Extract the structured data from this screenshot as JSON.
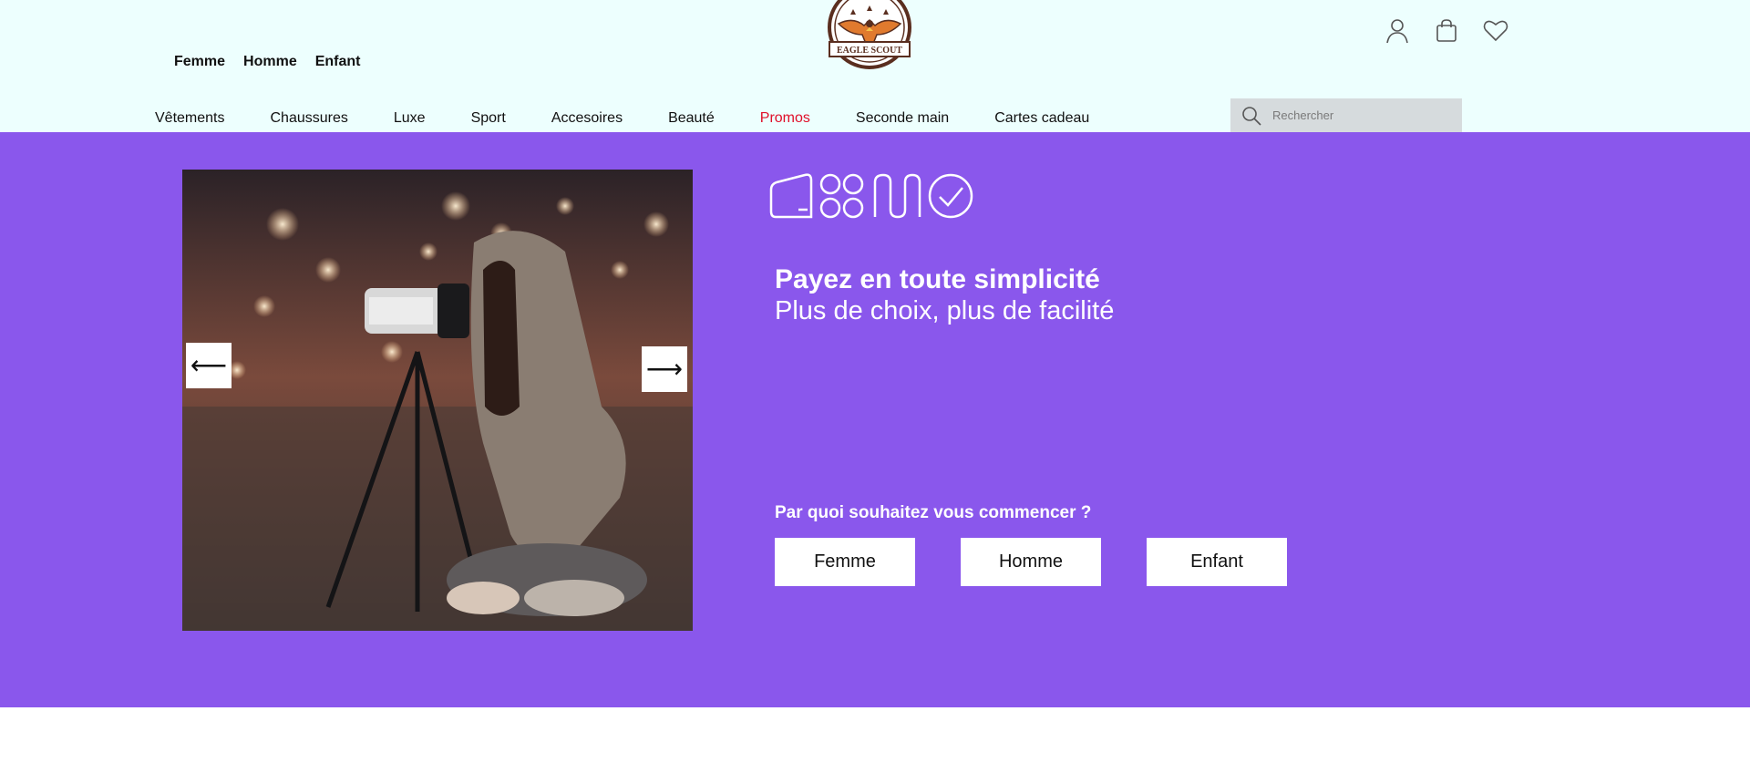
{
  "header": {
    "logo_text": "EAGLE SCOUT",
    "gender_links": [
      "Femme",
      "Homme",
      "Enfant"
    ],
    "icons": [
      "user-icon",
      "bag-icon",
      "heart-icon"
    ],
    "categories": [
      {
        "label": "Vêtements",
        "color": "#111111"
      },
      {
        "label": "Chaussures",
        "color": "#111111"
      },
      {
        "label": "Luxe",
        "color": "#111111"
      },
      {
        "label": "Sport",
        "color": "#111111"
      },
      {
        "label": "Accesoires",
        "color": "#111111"
      },
      {
        "label": "Beauté",
        "color": "#111111"
      },
      {
        "label": "Promos",
        "color": "#e0102a"
      },
      {
        "label": "Seconde main",
        "color": "#111111"
      },
      {
        "label": "Cartes cadeau",
        "color": "#111111"
      }
    ],
    "search": {
      "placeholder": "Rechercher",
      "value": ""
    }
  },
  "hero": {
    "background": "#8a57ec",
    "carousel": {
      "prev_label": "⟵",
      "next_label": "⟶"
    },
    "title": "Payez en toute simplicité",
    "subtitle": "Plus de choix, plus de facilité",
    "question": "Par quoi souhaitez vous commencer ?",
    "choices": [
      "Femme",
      "Homme",
      "Enfant"
    ]
  }
}
